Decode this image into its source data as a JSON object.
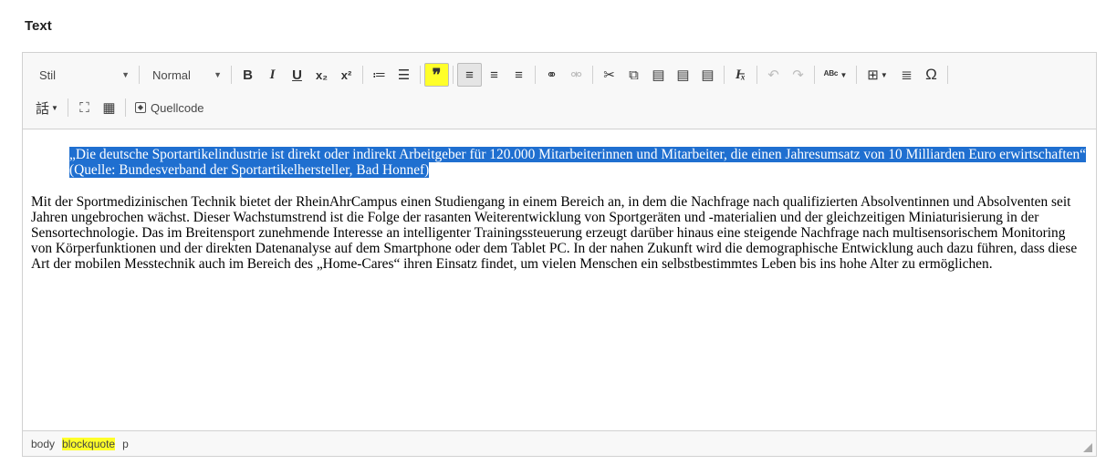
{
  "field_label": "Text",
  "toolbar": {
    "style_combo": "Stil",
    "format_combo": "Normal",
    "bold": "B",
    "italic": "I",
    "underline": "U",
    "subscript": "x₂",
    "superscript": "x²",
    "numbered_list": "≔",
    "bulleted_list": "☰",
    "blockquote": "❞",
    "align_left": "≡",
    "align_center": "≡",
    "align_right": "≡",
    "link": "⚭",
    "unlink": "⚮",
    "cut": "✂",
    "copy": "⧉",
    "paste": "▤",
    "paste_text": "▤",
    "paste_word": "▤",
    "remove_format": "I̶ₓ",
    "undo": "↶",
    "redo": "↷",
    "spellcheck": "ᴬᴮᶜ",
    "table": "⊞",
    "horizontal_line": "≣",
    "special_char": "Ω",
    "language": "話",
    "maximize": "⛶",
    "show_blocks": "▦",
    "source_label": "Quellcode"
  },
  "content": {
    "quote": "„Die deutsche Sportartikelindustrie ist direkt oder indirekt Arbeitgeber für 120.000 Mitarbeiterinnen und Mitarbeiter, die einen Jahresumsatz von 10 Milliarden Euro erwirtschaften“ (Quelle: Bundesverband der Sportartikelhersteller, Bad Honnef)",
    "paragraph": "Mit der Sportmedizinischen Technik bietet der RheinAhrCampus einen Studiengang in einem Bereich an, in dem die Nachfrage nach qualifizierten Absolventinnen und Absolventen seit Jahren ungebrochen wächst. Dieser Wachstumstrend ist die Folge der rasanten Weiterentwicklung von Sportgeräten und -materialien und der gleichzeitigen Miniaturisierung in der Sensortechnologie. Das im Breitensport zunehmende Interesse an intelligenter Trainingssteuerung erzeugt darüber hinaus eine steigende Nachfrage nach multisensorischem Monitoring von Körperfunktionen und der direkten Datenanalyse auf dem Smartphone oder dem Tablet PC. In der nahen Zukunft wird die demographische Entwicklung auch dazu führen, dass diese Art der mobilen Messtechnik auch im Bereich des „Home-Cares“ ihren Einsatz findet, um vielen Menschen ein selbstbestimmtes Leben bis ins hohe Alter zu ermöglichen."
  },
  "statusbar": {
    "path": [
      "body",
      "blockquote",
      "p"
    ]
  },
  "colors": {
    "highlight": "#ffff2a",
    "selection": "#1f6fd0"
  }
}
